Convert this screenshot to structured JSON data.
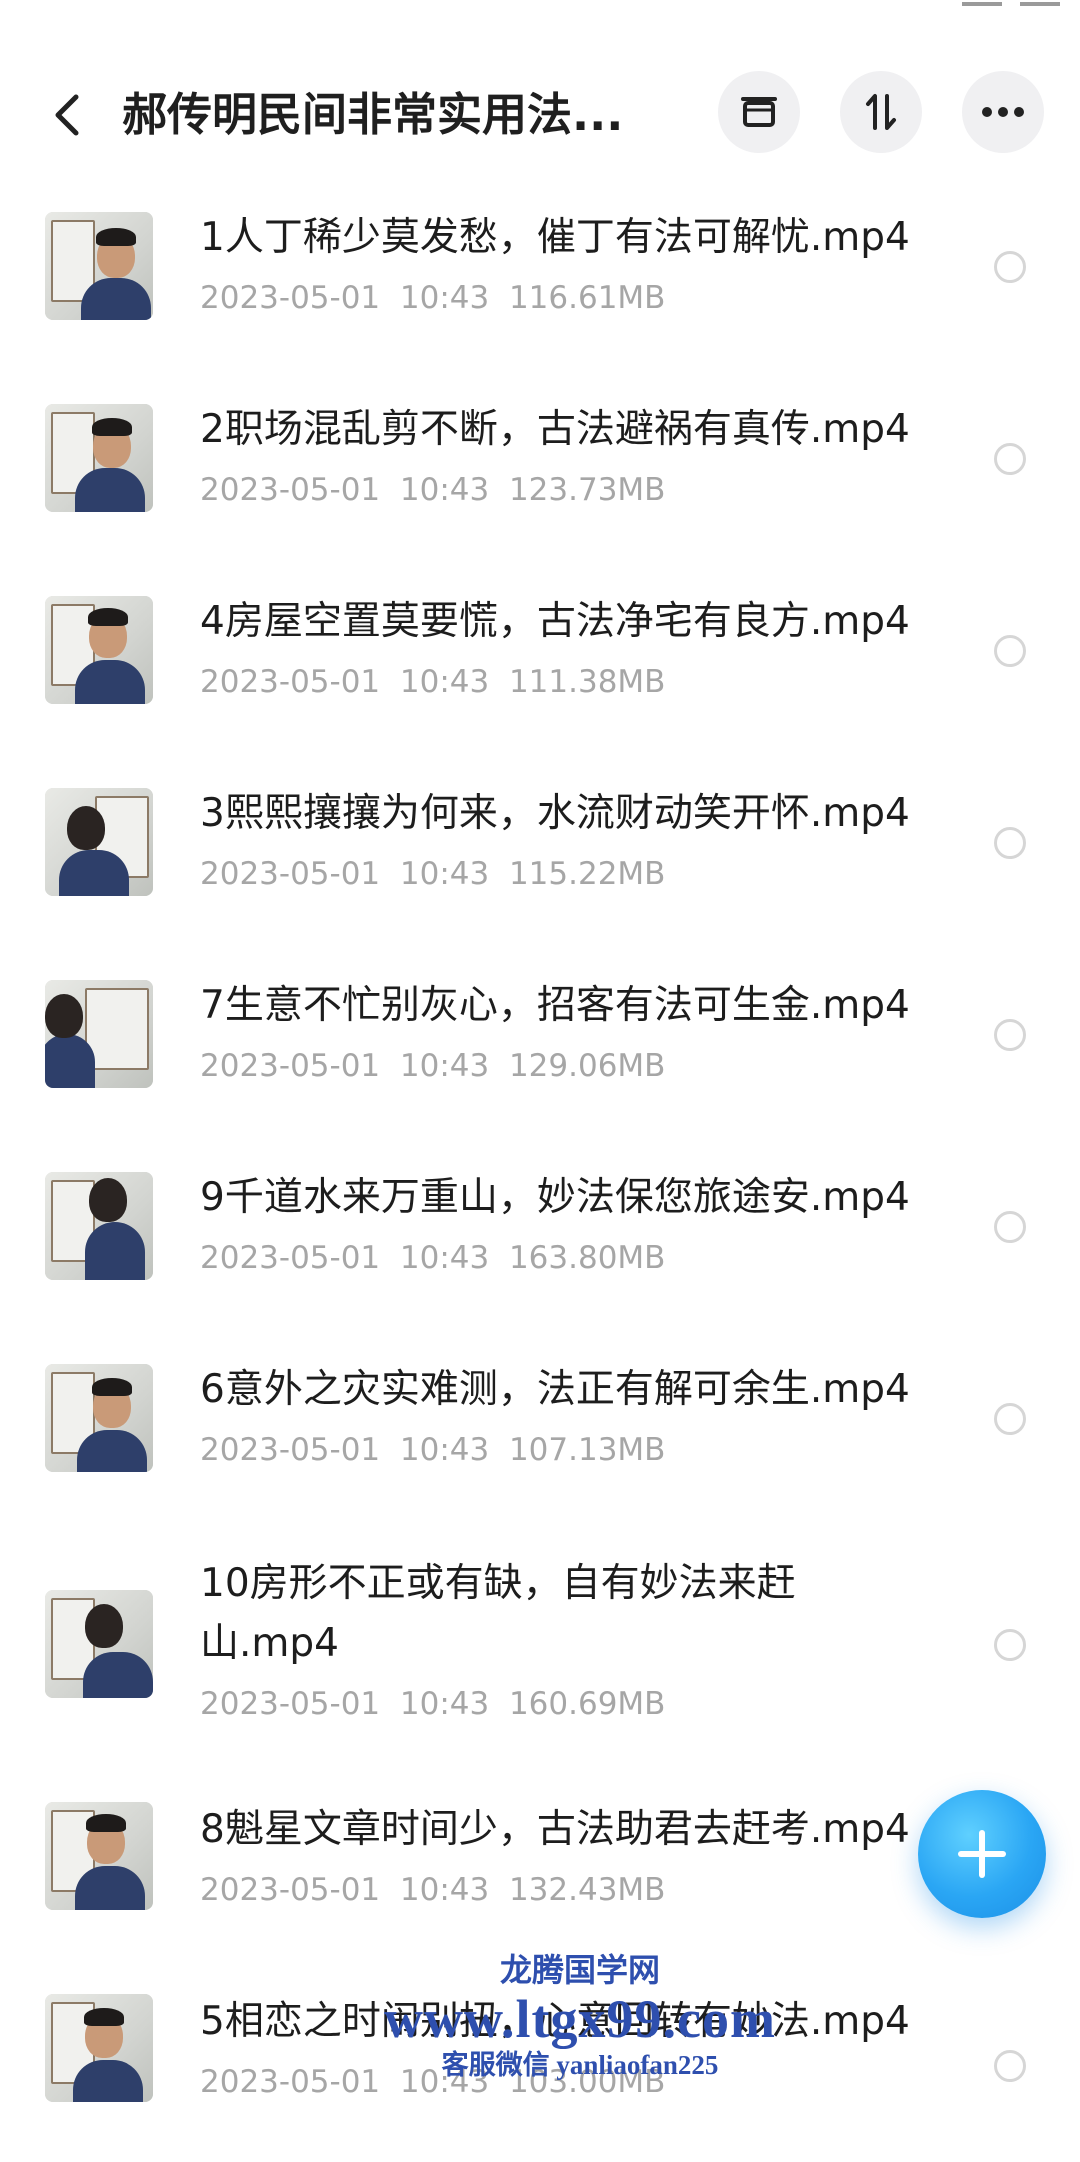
{
  "header": {
    "title": "郝传明民间非常实用法...",
    "archive_icon": "archive-box-icon",
    "sort_icon": "sort-arrows-icon",
    "more_icon": "more-dots-icon"
  },
  "files": [
    {
      "name": "1人丁稀少莫发愁，催丁有法可解忧.mp4",
      "date": "2023-05-01",
      "time": "10:43",
      "size": "116.61MB"
    },
    {
      "name": "2职场混乱剪不断，古法避祸有真传.mp4",
      "date": "2023-05-01",
      "time": "10:43",
      "size": "123.73MB"
    },
    {
      "name": "4房屋空置莫要慌，古法净宅有良方.mp4",
      "date": "2023-05-01",
      "time": "10:43",
      "size": "111.38MB"
    },
    {
      "name": "3熙熙攘攘为何来，水流财动笑开怀.mp4",
      "date": "2023-05-01",
      "time": "10:43",
      "size": "115.22MB"
    },
    {
      "name": "7生意不忙别灰心，招客有法可生金.mp4",
      "date": "2023-05-01",
      "time": "10:43",
      "size": "129.06MB"
    },
    {
      "name": "9千道水来万重山，妙法保您旅途安.mp4",
      "date": "2023-05-01",
      "time": "10:43",
      "size": "163.80MB"
    },
    {
      "name": "6意外之灾实难测，法正有解可余生.mp4",
      "date": "2023-05-01",
      "time": "10:43",
      "size": "107.13MB"
    },
    {
      "name": "10房形不正或有缺，自有妙法来赶山.mp4",
      "date": "2023-05-01",
      "time": "10:43",
      "size": "160.69MB"
    },
    {
      "name": "8魁星文章时间少，古法助君去赶考.mp4",
      "date": "2023-05-01",
      "time": "10:43",
      "size": "132.43MB"
    },
    {
      "name": "5相恋之时闹别扭，心意回转有妙法.mp4",
      "date": "2023-05-01",
      "time": "10:43",
      "size": "103.00MB"
    }
  ],
  "fab": {
    "icon": "plus-icon"
  },
  "watermark": {
    "line1": "龙腾国学网",
    "line2": "www.ltgx99.com",
    "line3": "客服微信 yanliaofan225"
  },
  "colors": {
    "accent": "#2aa6f4",
    "meta_text": "#a6a6a6",
    "watermark": "#2e4fae"
  }
}
